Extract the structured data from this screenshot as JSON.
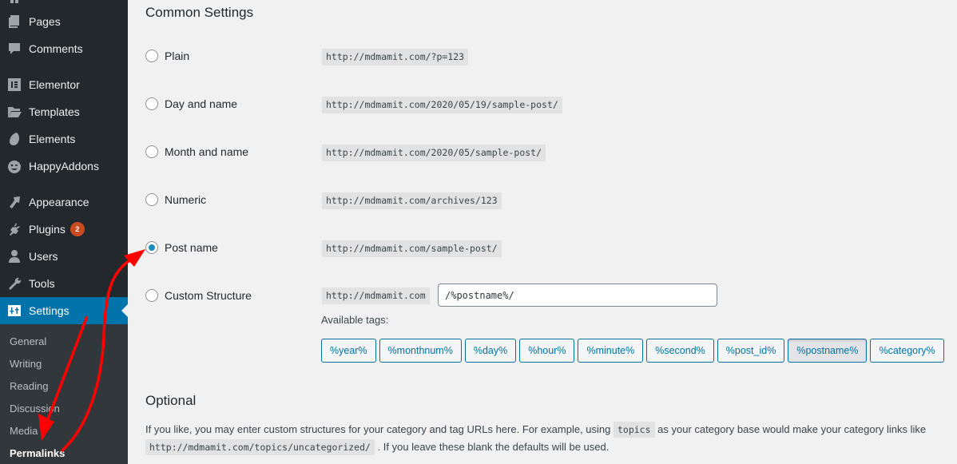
{
  "sidebar": {
    "items": [
      {
        "label": "Pages",
        "icon": "pages-icon"
      },
      {
        "label": "Comments",
        "icon": "comments-icon"
      },
      {
        "label": "Elementor",
        "icon": "elementor-icon"
      },
      {
        "label": "Templates",
        "icon": "folder-icon"
      },
      {
        "label": "Elements",
        "icon": "elements-icon"
      },
      {
        "label": "HappyAddons",
        "icon": "happyaddons-icon"
      },
      {
        "label": "Appearance",
        "icon": "paintbrush-icon"
      },
      {
        "label": "Plugins",
        "icon": "plugin-icon",
        "badge": "2"
      },
      {
        "label": "Users",
        "icon": "user-icon"
      },
      {
        "label": "Tools",
        "icon": "wrench-icon"
      },
      {
        "label": "Settings",
        "icon": "settings-icon",
        "active": true
      }
    ],
    "submenu": [
      {
        "label": "General"
      },
      {
        "label": "Writing"
      },
      {
        "label": "Reading"
      },
      {
        "label": "Discussion"
      },
      {
        "label": "Media"
      },
      {
        "label": "Permalinks",
        "current": true
      }
    ]
  },
  "main": {
    "common_heading": "Common Settings",
    "options": [
      {
        "label": "Plain",
        "example": "http://mdmamit.com/?p=123",
        "checked": false
      },
      {
        "label": "Day and name",
        "example": "http://mdmamit.com/2020/05/19/sample-post/",
        "checked": false
      },
      {
        "label": "Month and name",
        "example": "http://mdmamit.com/2020/05/sample-post/",
        "checked": false
      },
      {
        "label": "Numeric",
        "example": "http://mdmamit.com/archives/123",
        "checked": false
      },
      {
        "label": "Post name",
        "example": "http://mdmamit.com/sample-post/",
        "checked": true
      },
      {
        "label": "Custom Structure",
        "example": "http://mdmamit.com",
        "checked": false
      }
    ],
    "custom_structure_value": "/%postname%/",
    "available_tags_label": "Available tags:",
    "tags": [
      {
        "label": "%year%"
      },
      {
        "label": "%monthnum%"
      },
      {
        "label": "%day%"
      },
      {
        "label": "%hour%"
      },
      {
        "label": "%minute%"
      },
      {
        "label": "%second%"
      },
      {
        "label": "%post_id%"
      },
      {
        "label": "%postname%",
        "active": true
      },
      {
        "label": "%category%"
      }
    ],
    "optional_heading": "Optional",
    "optional_desc": {
      "part1": "If you like, you may enter custom structures for your category and tag URLs here. For example, using ",
      "code1": "topics",
      "part2": " as your category base would make your category links like ",
      "code2": "http://mdmamit.com/topics/uncategorized/",
      "part3": " . If you leave these blank the defaults will be used."
    }
  },
  "colors": {
    "sidebar_bg": "#23282d",
    "submenu_bg": "#32373c",
    "active_bg": "#0073aa",
    "accent": "#0071a1",
    "badge": "#ca4a1f",
    "annotation_arrow": "#ff0000"
  }
}
